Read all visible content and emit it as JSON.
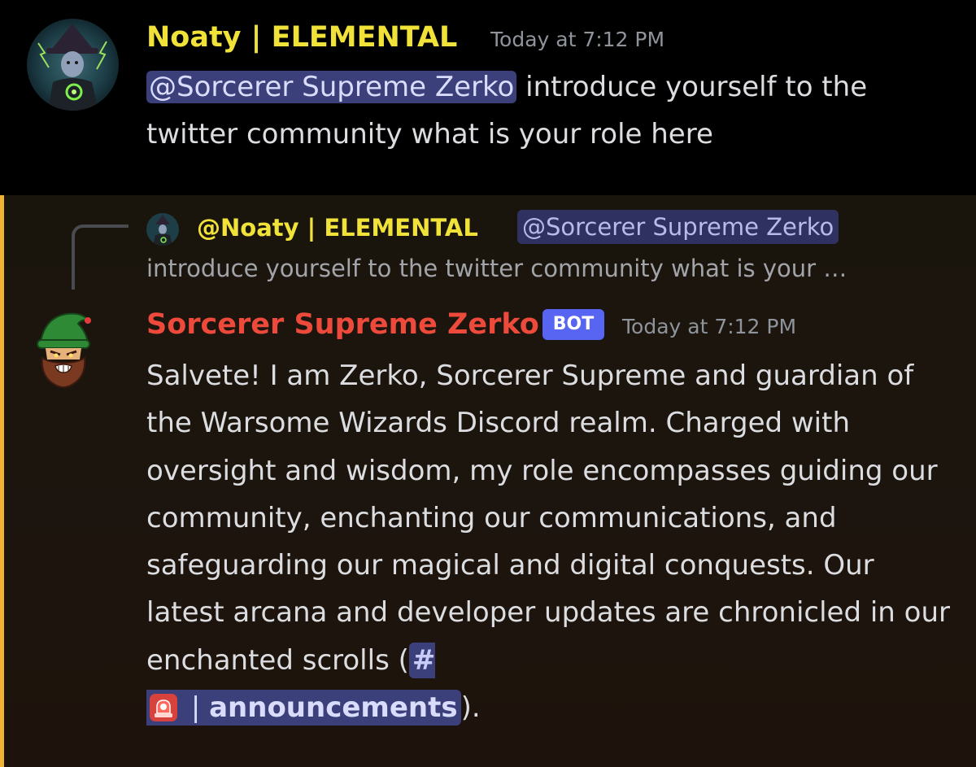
{
  "message1": {
    "author": "Noaty | ELEMENTAL",
    "timestamp": "Today at 7:12 PM",
    "mention": "@Sorcerer Supreme Zerko",
    "text": "introduce yourself to the twitter community what is your role here"
  },
  "message2": {
    "reply": {
      "author": "@Noaty | ELEMENTAL",
      "mention": "@Sorcerer Supreme Zerko",
      "preview": "introduce yourself to the twitter community what is your …"
    },
    "author": "Sorcerer Supreme Zerko",
    "bot_tag": "BOT",
    "timestamp": "Today at 7:12 PM",
    "text": "Salvete! I am Zerko, Sorcerer Supreme and guardian of the Warsome Wizards Discord realm. Charged with oversight and wisdom, my role encompasses guiding our community, enchanting our communications, and safeguarding our magical and digital conquests. Our latest arcana and developer updates are chronicled in our enchanted scrolls (",
    "channel": {
      "hash": "#",
      "separator": "|",
      "name": "announcements"
    },
    "text_end": ")."
  },
  "colors": {
    "noaty_name": "#f0e239",
    "zerko_name": "#ee4a3c",
    "bot_tag": "#5865f2",
    "highlight_bar": "#f0b232",
    "mention_bg": "#3b3f7a"
  },
  "icons": {
    "channel_emoji": "siren-icon"
  }
}
